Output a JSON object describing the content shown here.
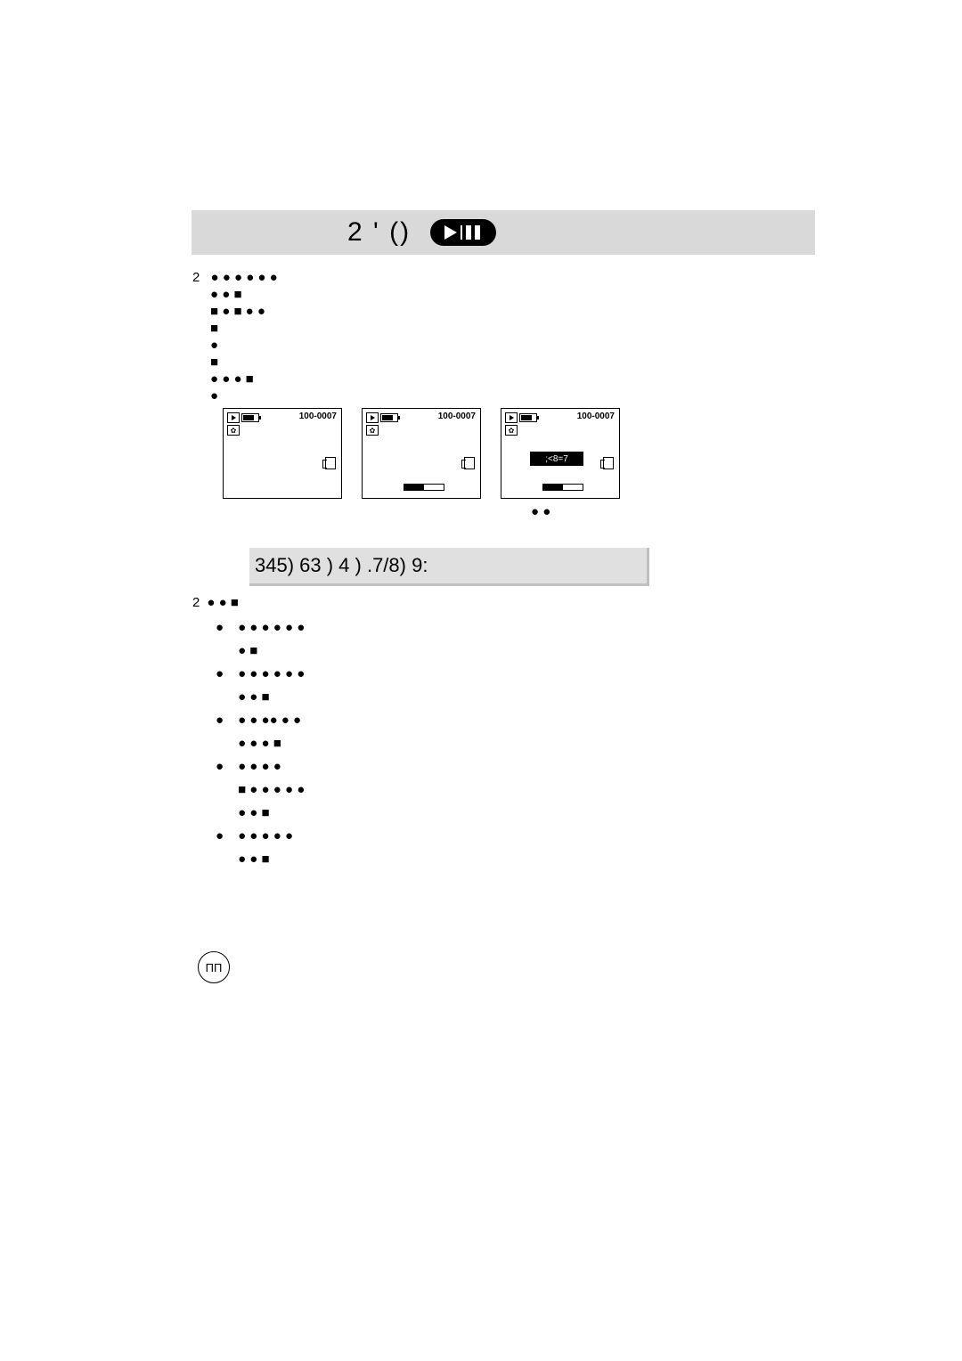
{
  "header": {
    "line": "2   '        ()"
  },
  "body1": {
    "num": "2",
    "l1": " ●   ● ●    ● ●   ●",
    "l2": "● ●  ■",
    "l3": "■ ●    ■  ● ●",
    "l4": "■",
    "l5": "  ●",
    "l6": "             ■",
    "l7": "   ● ● ●  ■",
    "l8": "  ●"
  },
  "panels": {
    "id": "100-0007",
    "banner": ";<8=7"
  },
  "panelCaption": "● ●",
  "section2": {
    "title": "345)  63    )  4    ) .7/8) 9:",
    "num": "2",
    "l1": "●      ●  ■",
    "rows": [
      {
        "k": "●",
        "v": "   ● ●    ● ●      ● ●"
      },
      {
        "k": "",
        "v": "             ●  ■"
      },
      {
        "k": "●",
        "v": "            ● ●     ●    ● ● ●"
      },
      {
        "k": "",
        "v": "            ●    ●  ■"
      },
      {
        "k": "●",
        "v": "   ●    ●   ●● ● ●"
      },
      {
        "k": "",
        "v": "            ● ●   ●  ■"
      },
      {
        "k": "●",
        "v": "            ● ●       ●        ●"
      },
      {
        "k": "",
        "v": "        ■  ● ●    ● ●  ●"
      },
      {
        "k": "",
        "v": "            ● ●  ■"
      },
      {
        "k": "●",
        "v": "            ●  ●    ● ●    ●"
      },
      {
        "k": "",
        "v": "            ●  ●     ■"
      }
    ]
  },
  "pageNumber": "ПП"
}
